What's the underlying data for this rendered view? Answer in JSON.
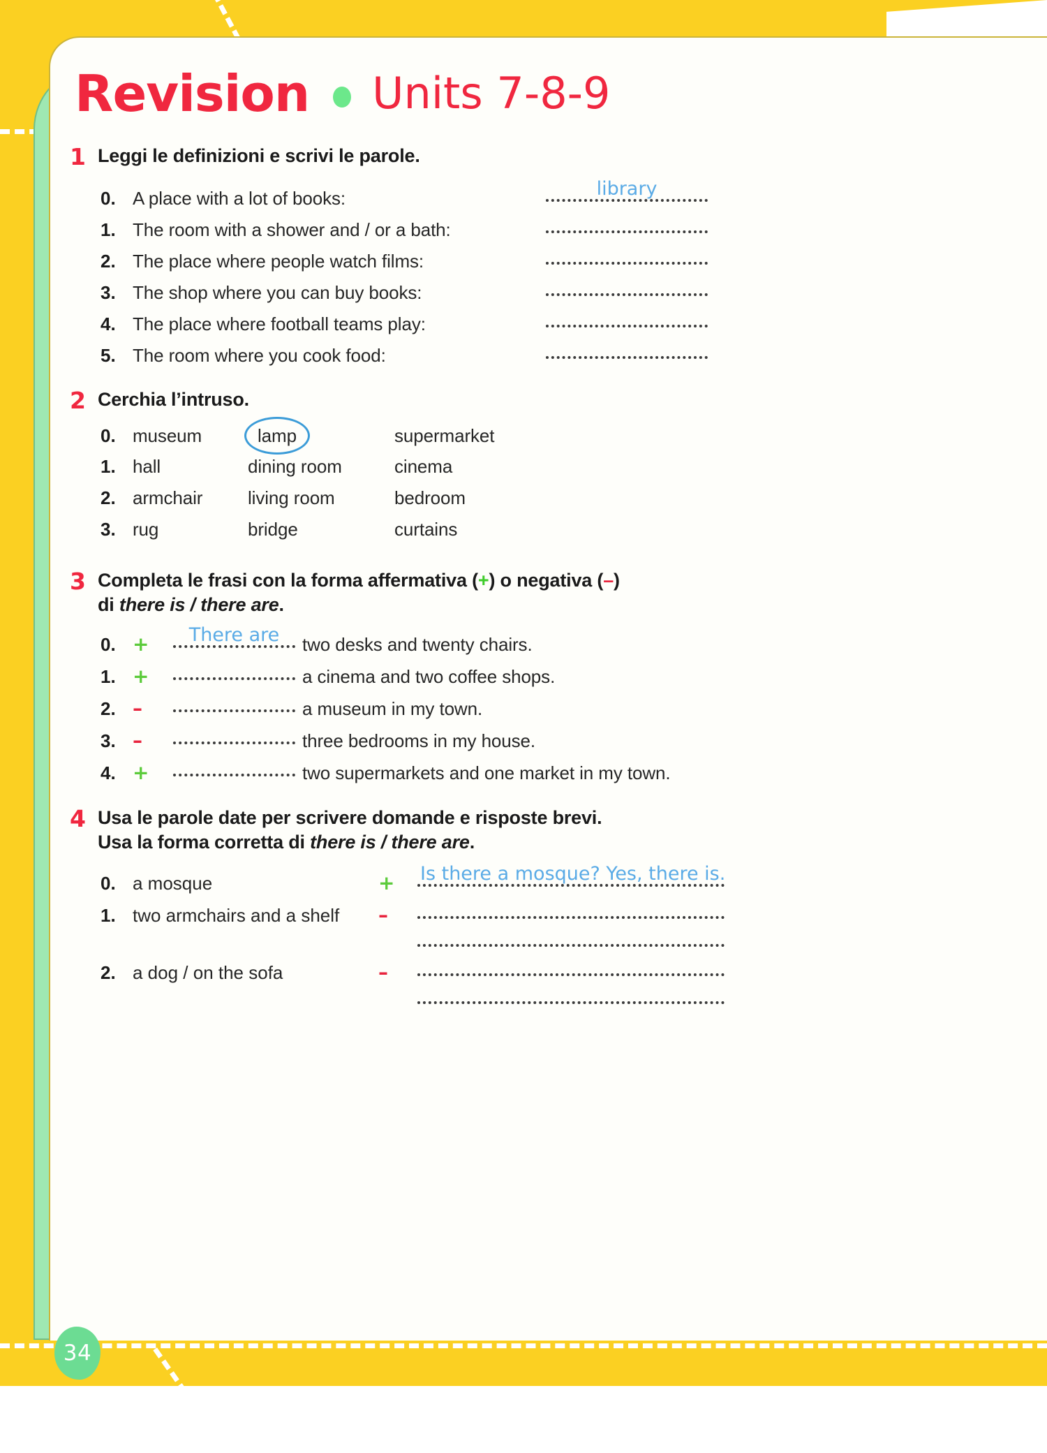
{
  "page": {
    "number": "34",
    "accent_red": "#F0273F",
    "accent_green": "#6CE88B",
    "handwriting_blue": "#5AABE6",
    "background_yellow": "#FBD022"
  },
  "header": {
    "title": "Revision",
    "separator_dot": "green-dot",
    "subtitle": "Units 7-8-9"
  },
  "exercises": [
    {
      "number": "1",
      "instruction": "Leggi le definizioni e scrivi le parole.",
      "items": [
        {
          "num": "0.",
          "text": "A place with a lot of books:",
          "answer": "library"
        },
        {
          "num": "1.",
          "text": "The room with a shower and / or a bath:",
          "answer": ""
        },
        {
          "num": "2.",
          "text": "The place where people watch films:",
          "answer": ""
        },
        {
          "num": "3.",
          "text": "The shop where you can buy books:",
          "answer": ""
        },
        {
          "num": "4.",
          "text": "The place where football teams play:",
          "answer": ""
        },
        {
          "num": "5.",
          "text": "The room where you cook food:",
          "answer": ""
        }
      ]
    },
    {
      "number": "2",
      "instruction": "Cerchia l’intruso.",
      "items": [
        {
          "num": "0.",
          "options": [
            "museum",
            "lamp",
            "supermarket"
          ],
          "circled": 1
        },
        {
          "num": "1.",
          "options": [
            "hall",
            "dining room",
            "cinema"
          ],
          "circled": -1
        },
        {
          "num": "2.",
          "options": [
            "armchair",
            "living room",
            "bedroom"
          ],
          "circled": -1
        },
        {
          "num": "3.",
          "options": [
            "rug",
            "bridge",
            "curtains"
          ],
          "circled": -1
        }
      ]
    },
    {
      "number": "3",
      "instruction_line1_a": "Completa le frasi con la forma affermativa (",
      "instruction_plus": "+",
      "instruction_line1_b": ") o negativa (",
      "instruction_minus": "–",
      "instruction_line1_c": ")",
      "instruction_line2_a": "di ",
      "instruction_line2_italic": "there is / there are",
      "instruction_line2_b": ".",
      "items": [
        {
          "num": "0.",
          "sign": "+",
          "answer": "There are",
          "text": "two desks and twenty chairs."
        },
        {
          "num": "1.",
          "sign": "+",
          "answer": "",
          "text": "a cinema and two coffee shops."
        },
        {
          "num": "2.",
          "sign": "–",
          "answer": "",
          "text": "a museum in my town."
        },
        {
          "num": "3.",
          "sign": "–",
          "answer": "",
          "text": "three bedrooms in my house."
        },
        {
          "num": "4.",
          "sign": "+",
          "answer": "",
          "text": "two supermarkets and one market in my town."
        }
      ]
    },
    {
      "number": "4",
      "instruction_line1": "Usa le parole date per scrivere domande e risposte brevi.",
      "instruction_line2_a": "Usa la forma corretta di ",
      "instruction_line2_italic": "there is / there are",
      "instruction_line2_b": ".",
      "items": [
        {
          "num": "0.",
          "prompt": "a mosque",
          "sign": "+",
          "answer": "Is there a mosque? Yes, there is.",
          "extra_line": false
        },
        {
          "num": "1.",
          "prompt": "two armchairs and a shelf",
          "sign": "–",
          "answer": "",
          "extra_line": true
        },
        {
          "num": "2.",
          "prompt": "a dog / on the sofa",
          "sign": "–",
          "answer": "",
          "extra_line": true
        }
      ]
    }
  ]
}
